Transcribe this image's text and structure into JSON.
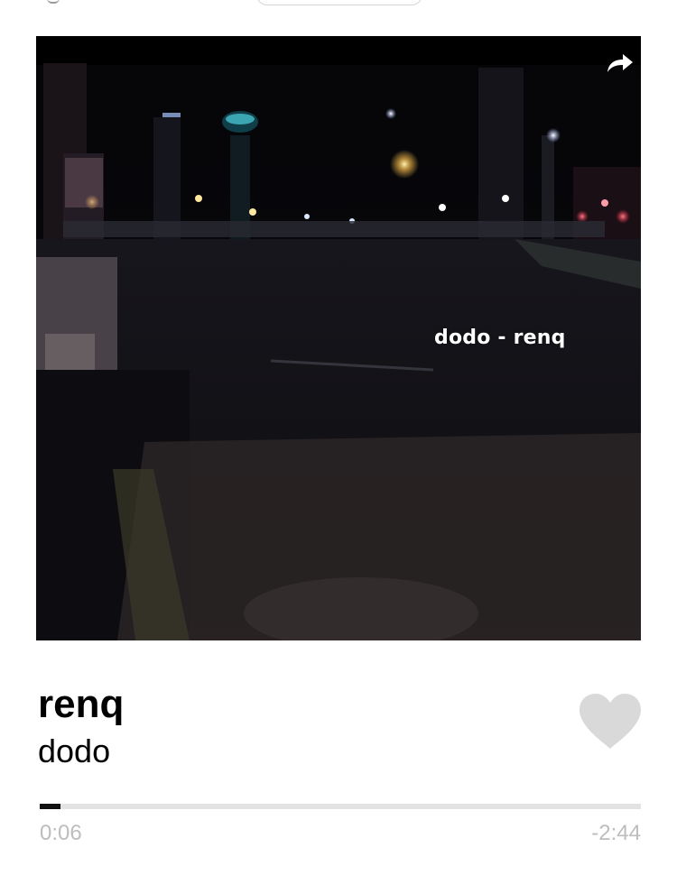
{
  "artwork": {
    "overlay_text": "dodo - renq",
    "description_icon": "share-icon"
  },
  "now_playing": {
    "artist": "renq",
    "track": "dodo",
    "liked_icon": "heart-icon",
    "heart_color": "#d9d9d9"
  },
  "playback": {
    "elapsed": "0:06",
    "remaining": "-2:44",
    "progress": 0.035
  },
  "colors": {
    "progress_fill": "#111111",
    "progress_track": "#e3e3e3",
    "time_text": "#bdbdbd"
  }
}
